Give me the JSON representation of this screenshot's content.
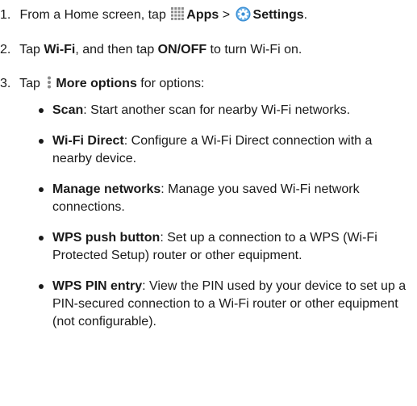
{
  "steps": [
    {
      "number": "1.",
      "pre": "From a Home screen, tap ",
      "icon1": "apps-grid-icon",
      "bold1": "Apps",
      "mid": " > ",
      "icon2": "settings-gear-icon",
      "bold2": "Settings",
      "post": "."
    },
    {
      "number": "2.",
      "pre": "Tap ",
      "bold1": "Wi-Fi",
      "mid": ", and then tap ",
      "bold2": "ON/OFF",
      "post": " to turn Wi-Fi on."
    },
    {
      "number": "3.",
      "pre": "Tap ",
      "icon": "more-options-icon",
      "bold": "More options",
      "post": " for options:"
    }
  ],
  "options": [
    {
      "term": "Scan",
      "desc": ": Start another scan for nearby Wi-Fi networks."
    },
    {
      "term": "Wi-Fi Direct",
      "desc": ": Configure a Wi-Fi Direct connection with a nearby device."
    },
    {
      "term": "Manage networks",
      "desc": ": Manage you saved Wi-Fi network connections."
    },
    {
      "term": "WPS push button",
      "desc": ": Set up a connection to a WPS (Wi-Fi Protected Setup) router or other equipment."
    },
    {
      "term": "WPS PIN entry",
      "desc": ": View the PIN used by your device to set up a PIN-secured connection to a Wi-Fi router or other equipment (not configurable)."
    }
  ],
  "colors": {
    "text": "#1a1a1a",
    "settings_icon_blue": "#3b8fd4"
  }
}
